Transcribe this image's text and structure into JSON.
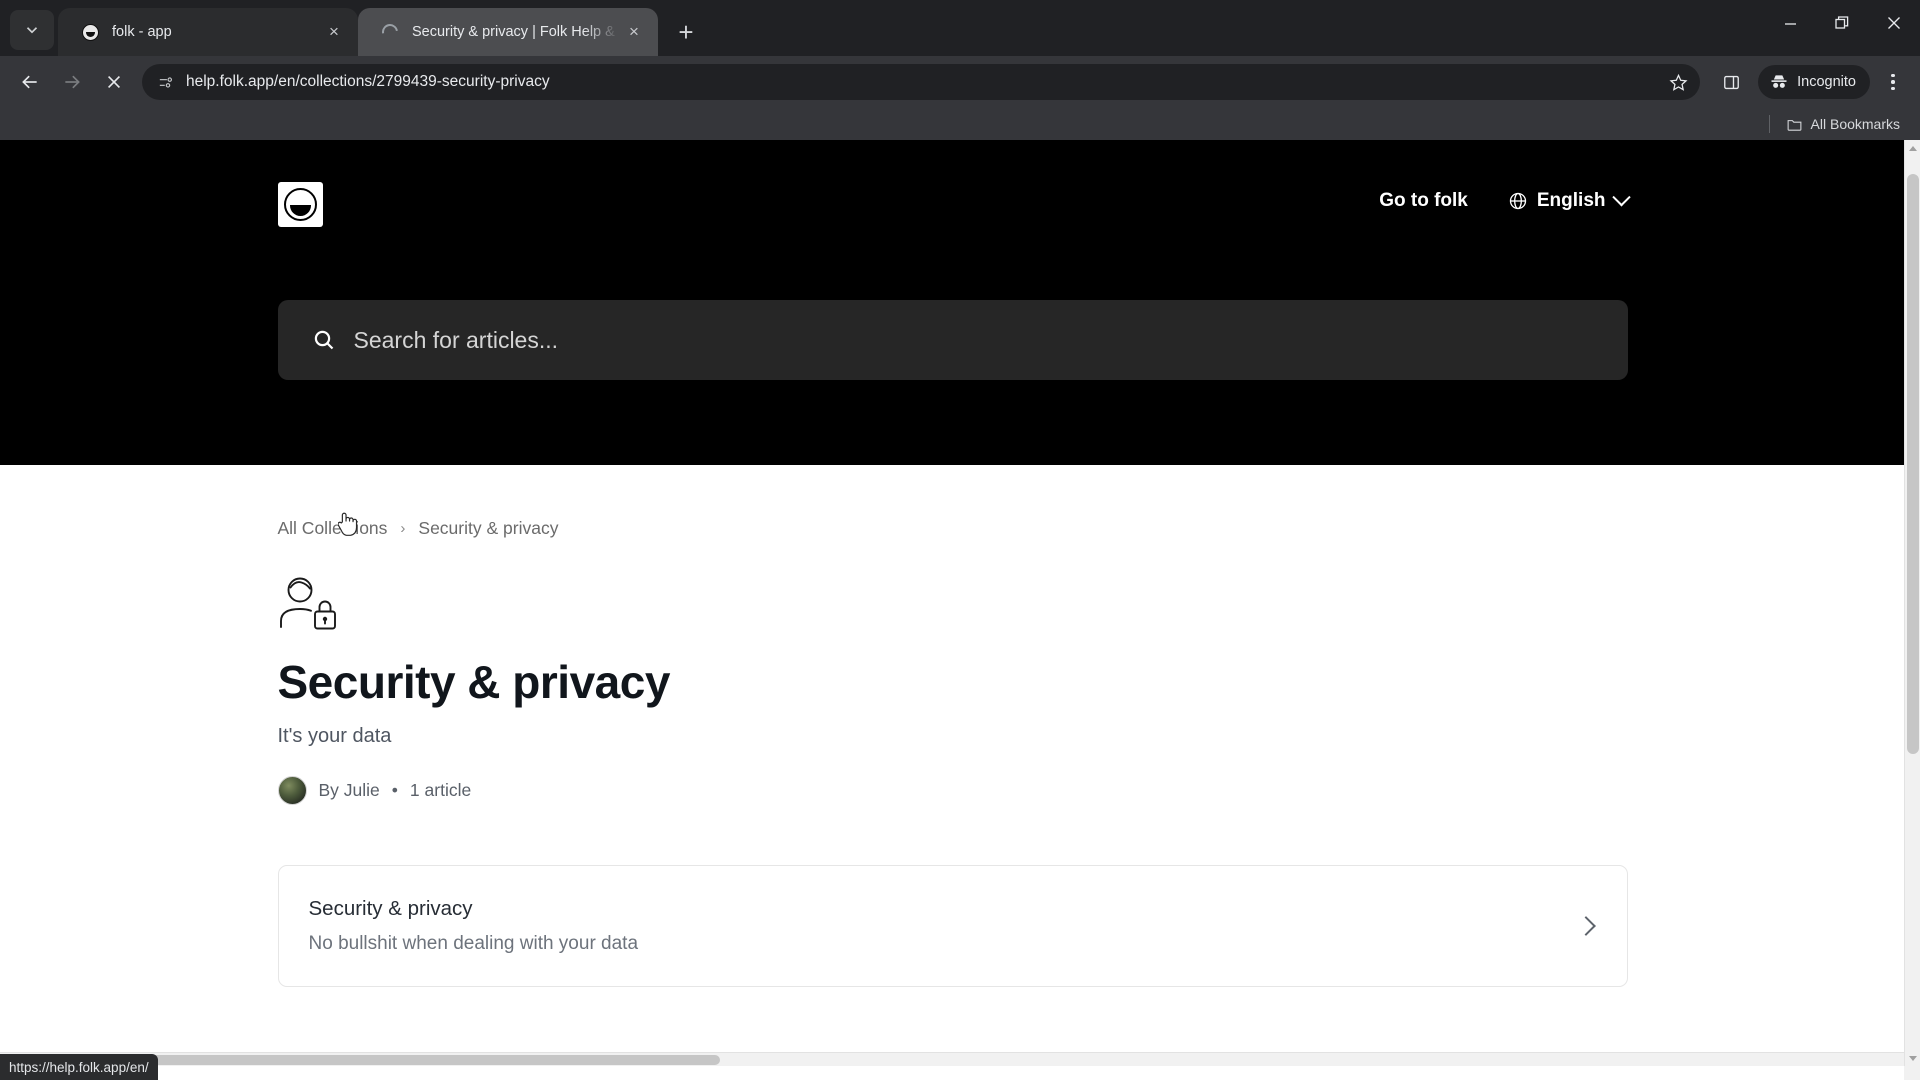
{
  "browser": {
    "tab_search_icon": "chevron-down-icon",
    "tabs": [
      {
        "title": "folk - app",
        "favicon": "folk-logo-icon",
        "active": false,
        "loading": false,
        "close_label": "×"
      },
      {
        "title": "Security & privacy | Folk Help &",
        "favicon": "loading-spinner-icon",
        "active": true,
        "loading": true,
        "close_label": "×"
      }
    ],
    "new_tab_label": "+",
    "window_controls": {
      "minimize": "minimize-icon",
      "maximize": "maximize-icon",
      "close": "close-icon"
    },
    "toolbar": {
      "back": "back-arrow-icon",
      "forward": "forward-arrow-icon",
      "stop": "stop-loading-icon",
      "site_info_icon": "page-info-icon",
      "url": "help.folk.app/en/collections/2799439-security-privacy",
      "url_placeholder": "Search Google or type a URL",
      "bookmark_icon": "star-icon",
      "side_panel_icon": "side-panel-icon",
      "incognito_label": "Incognito",
      "incognito_icon": "incognito-icon",
      "menu_icon": "three-dots-menu-icon"
    },
    "bookmarks_bar": {
      "all_bookmarks_label": "All Bookmarks",
      "folder_icon": "folder-icon"
    },
    "status_bubble": "https://help.folk.app/en/"
  },
  "site": {
    "logo_alt": "folk-logo",
    "nav": {
      "go_to_folk": "Go to folk",
      "language": "English",
      "language_icon": "globe-icon",
      "language_chevron": "chevron-down-icon"
    },
    "search": {
      "placeholder": "Search for articles...",
      "icon": "search-icon"
    }
  },
  "main": {
    "breadcrumb": {
      "items": [
        {
          "label": "All Collections",
          "link": true
        },
        {
          "label": "Security & privacy",
          "link": false
        }
      ],
      "separator": "›"
    },
    "collection_icon": "person-with-lock-icon",
    "title": "Security & privacy",
    "subtitle": "It's your data",
    "author_prefix": "By Julie",
    "meta_separator": "•",
    "article_count": "1 article",
    "articles": [
      {
        "title": "Security & privacy",
        "description": "No bullshit when dealing with your data",
        "chevron": "chevron-right-icon"
      }
    ]
  },
  "colors": {
    "header_bg": "#000000",
    "search_bg": "#262626",
    "chrome_toolbar": "#35363a",
    "chrome_tabstrip": "#202124",
    "active_tab": "#4c4d50",
    "page_bg": "#ffffff",
    "title_color": "#11161c",
    "muted_text": "#6b6b6b"
  }
}
